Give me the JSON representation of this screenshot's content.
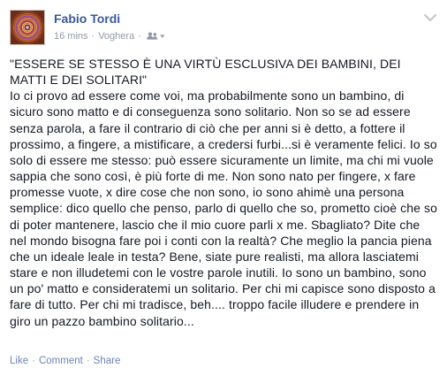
{
  "post": {
    "author_name": "Fabio Tordi",
    "timestamp": "16 mins",
    "separator": "·",
    "location": "Voghera",
    "audience_icon": "friends-icon",
    "menu_icon": "chevron-down-icon",
    "avatar_icon": "mandala-avatar",
    "title_quote": "\"ESSERE SE STESSO È UNA VIRTÙ ESCLUSIVA DEI BAMBINI, DEI MATTI E DEI SOLITARI\"",
    "body_text": "Io ci provo ad essere come voi, ma probabilmente sono un bambino, di sicuro sono matto e di conseguenza sono solitario. Non so se ad essere senza parola, a fare il contrario di ciò che per anni si è detto, a fottere il prossimo, a fingere, a mistificare, a credersi furbi...si è veramente felici. Io so solo di essere me stesso: può essere sicuramente un limite, ma chi mi vuole sappia che sono così, è più forte di me. Non sono nato per fingere, x fare promesse vuote, x dire cose che non sono, io sono ahimè una persona semplice: dico quello che penso, parlo di quello che so, prometto cioè che so di poter mantenere, lascio che il mio cuore parli x me. Sbagliato? Dite che nel mondo bisogna fare poi i conti con la realtà? Che meglio la pancia piena che un ideale leale in testa? Bene, siate pure realisti, ma allora lasciatemi stare e non illudetemi con le vostre parole inutili. Io sono un bambino, sono un po' matto e consideratemi un solitario. Per chi mi capisce sono disposto a fare di tutto. Per chi mi tradisce, beh.... troppo facile illudere e prendere in giro un pazzo bambino solitario..."
  },
  "actions": {
    "like_label": "Like",
    "comment_label": "Comment",
    "share_label": "Share",
    "separator": "·"
  },
  "colors": {
    "author_link": "#3b5998",
    "meta_text": "#9197a3",
    "action_link": "#6d84b4",
    "body_text": "#141823"
  }
}
